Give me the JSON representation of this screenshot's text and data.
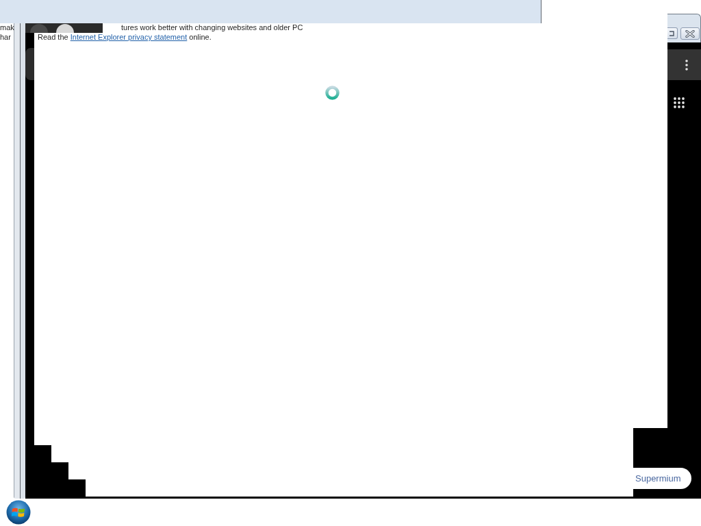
{
  "dialog": {
    "line_starts": [
      "mak",
      "har"
    ],
    "notice_tail": "tures work better with changing websites and older PC",
    "privacy": {
      "before": "Read the",
      "link": "Internet Explorer privacy statement",
      "after": "online."
    }
  },
  "browser": {
    "badge": "Supermium"
  }
}
